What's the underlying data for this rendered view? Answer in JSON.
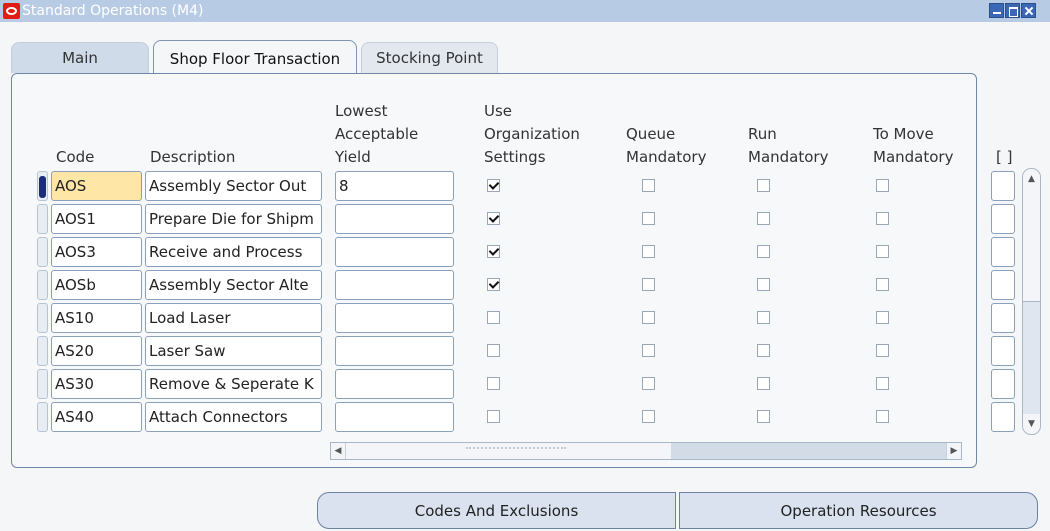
{
  "window": {
    "title": "Standard Operations (M4)"
  },
  "tabs": [
    {
      "label": "Main"
    },
    {
      "label": "Shop Floor Transaction"
    },
    {
      "label": "Stocking Point"
    }
  ],
  "columns": {
    "code": "Code",
    "description": "Description",
    "yield": "Lowest\nAcceptable\nYield",
    "use_org": "Use\nOrganization\nSettings",
    "queue": "Queue\nMandatory",
    "run": "Run\nMandatory",
    "to_move": "To Move\nMandatory",
    "extra": "[ ]"
  },
  "rows": [
    {
      "code": "AOS",
      "description": "Assembly Sector Out",
      "yield": "8",
      "use_org": true,
      "queue": false,
      "run": false,
      "to_move": false
    },
    {
      "code": "AOS1",
      "description": "Prepare Die for Shipm",
      "yield": "",
      "use_org": true,
      "queue": false,
      "run": false,
      "to_move": false
    },
    {
      "code": "AOS3",
      "description": "Receive and Process",
      "yield": "",
      "use_org": true,
      "queue": false,
      "run": false,
      "to_move": false
    },
    {
      "code": "AOSb",
      "description": "Assembly Sector Alte",
      "yield": "",
      "use_org": true,
      "queue": false,
      "run": false,
      "to_move": false
    },
    {
      "code": "AS10",
      "description": "Load Laser",
      "yield": "",
      "use_org": false,
      "queue": false,
      "run": false,
      "to_move": false
    },
    {
      "code": "AS20",
      "description": "Laser Saw",
      "yield": "",
      "use_org": false,
      "queue": false,
      "run": false,
      "to_move": false
    },
    {
      "code": "AS30",
      "description": "Remove & Seperate K",
      "yield": "",
      "use_org": false,
      "queue": false,
      "run": false,
      "to_move": false
    },
    {
      "code": "AS40",
      "description": "Attach Connectors",
      "yield": "",
      "use_org": false,
      "queue": false,
      "run": false,
      "to_move": false
    }
  ],
  "buttons": {
    "codes": "Codes And Exclusions",
    "resources": "Operation Resources"
  },
  "colors": {
    "titlebar": "#b8cbe4",
    "selected_cell": "#fde6a6",
    "button": "#d9e2ee"
  }
}
